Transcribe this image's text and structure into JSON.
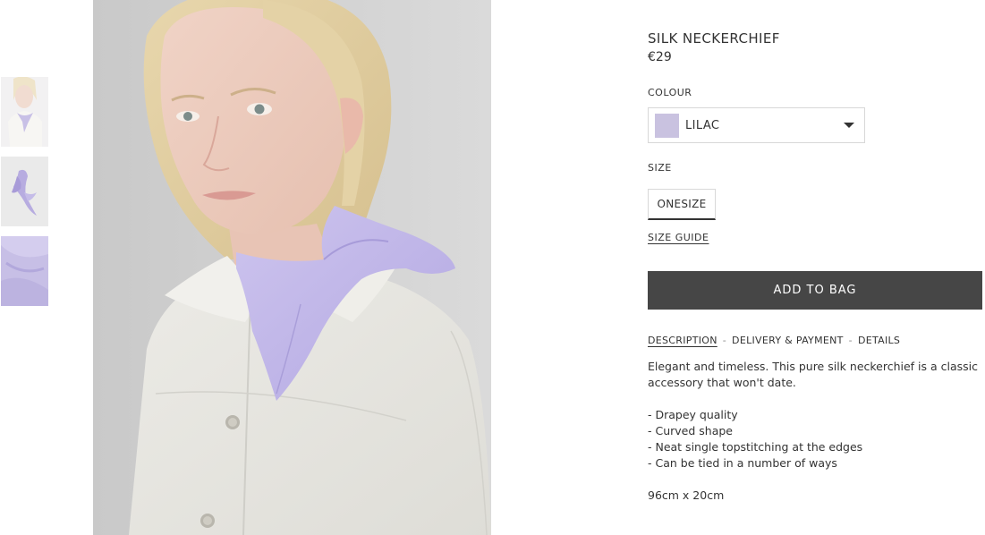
{
  "product": {
    "title": "SILK NECKERCHIEF",
    "price": "€29"
  },
  "colour": {
    "label": "COLOUR",
    "selected": "LILAC",
    "swatch_color": "#c9c2e0"
  },
  "size": {
    "label": "SIZE",
    "option": "ONESIZE",
    "guide_link": "SIZE GUIDE"
  },
  "cart": {
    "add_label": "ADD TO BAG",
    "button_color": "#464646"
  },
  "tabs": [
    {
      "label": "DESCRIPTION",
      "active": true
    },
    {
      "label": "DELIVERY & PAYMENT",
      "active": false
    },
    {
      "label": "DETAILS",
      "active": false
    }
  ],
  "tab_separator": "-",
  "description": {
    "intro": "Elegant and timeless. This pure silk neckerchief is a classic accessory that won't date.",
    "features": [
      "- Drapey quality",
      "- Curved shape",
      "- Neat single topstitching at the edges",
      "- Can be tied in a number of ways"
    ],
    "dimensions": "96cm x 20cm"
  },
  "gallery": {
    "thumbnails": [
      {
        "name": "model-wearing-scarf"
      },
      {
        "name": "scarf-tied-flat"
      },
      {
        "name": "fabric-closeup"
      }
    ],
    "main": "model-wearing-scarf-closeup"
  }
}
